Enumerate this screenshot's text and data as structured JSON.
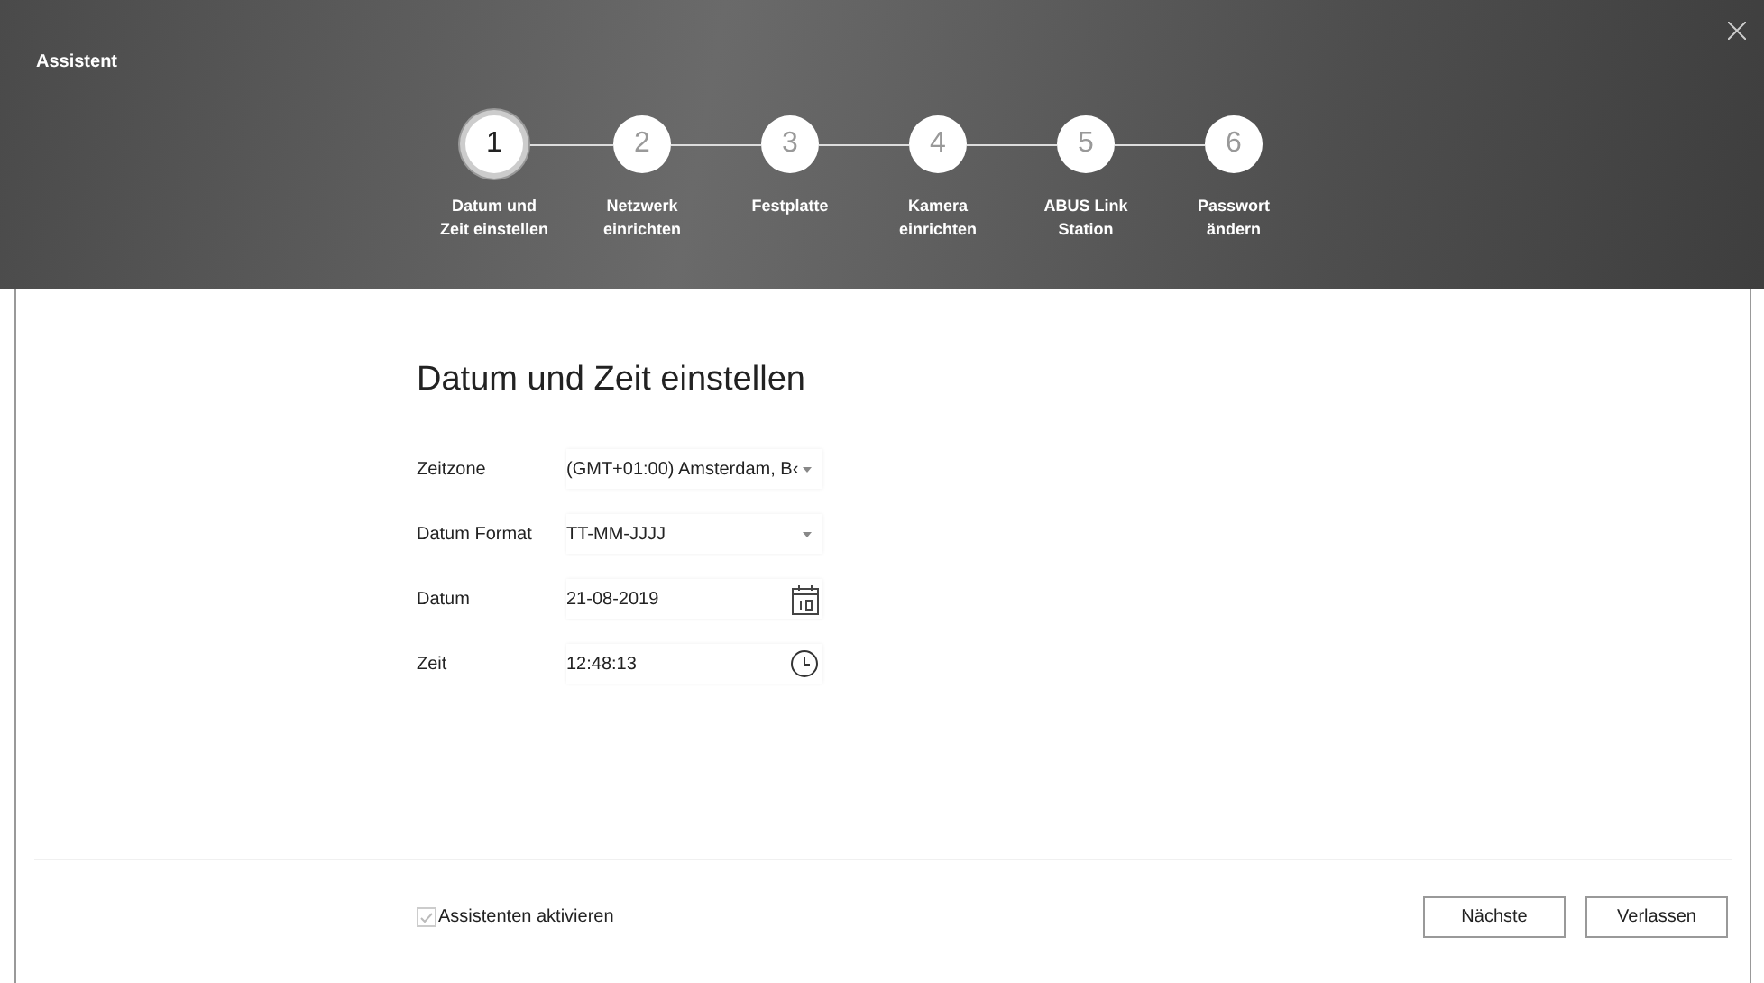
{
  "window": {
    "title": "Assistent"
  },
  "steps": [
    {
      "number": "1",
      "label": "Datum und Zeit einstellen",
      "selected": true
    },
    {
      "number": "2",
      "label": "Netzwerk einrichten",
      "selected": false
    },
    {
      "number": "3",
      "label": "Festplatte",
      "selected": false
    },
    {
      "number": "4",
      "label": "Kamera einrichten",
      "selected": false
    },
    {
      "number": "5",
      "label": "ABUS Link Station",
      "selected": false
    },
    {
      "number": "6",
      "label": "Passwort ändern",
      "selected": false
    }
  ],
  "heading": "Datum und Zeit einstellen",
  "fields": [
    {
      "label": "Zeitzone",
      "value": "(GMT+01:00) Amsterdam, B‹",
      "kind": "select"
    },
    {
      "label": "Datum Format",
      "value": "TT-MM-JJJJ",
      "kind": "select"
    },
    {
      "label": "Datum",
      "value": "21-08-2019",
      "kind": "date"
    },
    {
      "label": "Zeit",
      "value": "12:48:13",
      "kind": "time"
    }
  ],
  "footer": {
    "checkbox": {
      "label": "Assistenten aktivieren",
      "checked": true,
      "disabled": true
    },
    "buttons": [
      "Nächste",
      "Verlassen"
    ]
  }
}
